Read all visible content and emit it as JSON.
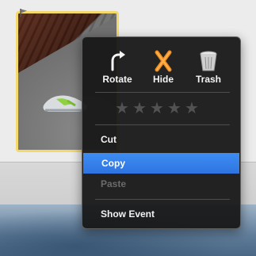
{
  "context_menu": {
    "actions": [
      {
        "label": "Rotate",
        "icon": "rotate-icon"
      },
      {
        "label": "Hide",
        "icon": "hide-x-icon"
      },
      {
        "label": "Trash",
        "icon": "trash-icon"
      }
    ],
    "rating": {
      "stars_total": 5,
      "stars_filled": 0,
      "glyph": "★"
    },
    "items": [
      {
        "label": "Cut",
        "enabled": true,
        "highlighted": false
      },
      {
        "label": "Copy",
        "enabled": true,
        "highlighted": true
      },
      {
        "label": "Paste",
        "enabled": false,
        "highlighted": false
      },
      {
        "label": "Show Event",
        "enabled": true,
        "highlighted": false
      }
    ]
  },
  "colors": {
    "selection_border": "#f3d86b",
    "highlight": "#3584ec",
    "hide_icon": "#f08a1c",
    "disabled_text": "#6b6b6b"
  }
}
